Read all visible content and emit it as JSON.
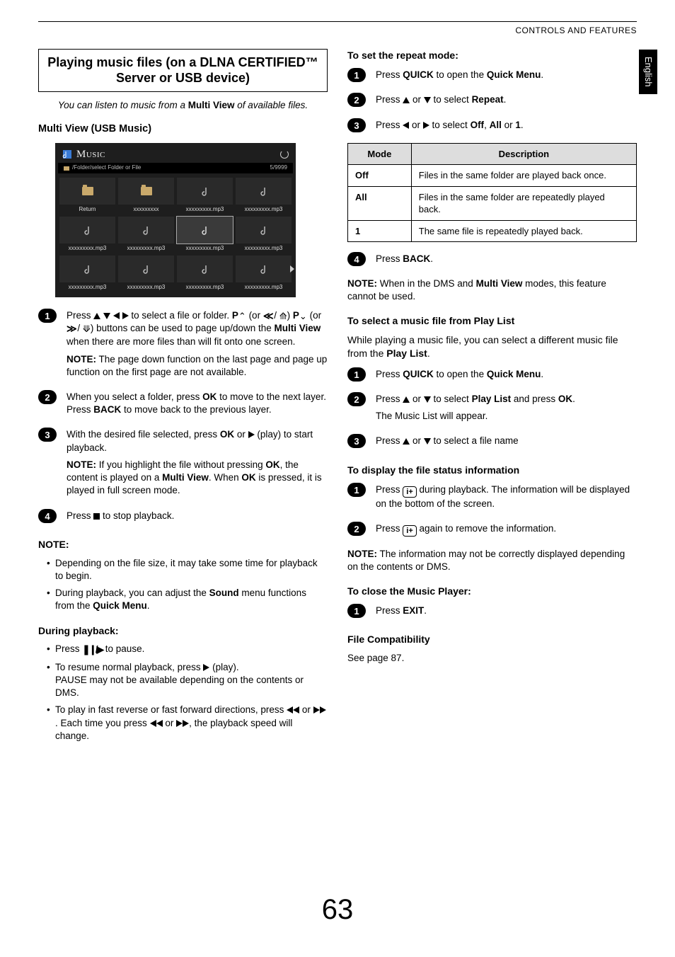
{
  "header": {
    "section": "CONTROLS AND FEATURES",
    "language": "English"
  },
  "page_number": "63",
  "left": {
    "title": "Playing music files (on a DLNA CERTIFIED™ Server or USB device)",
    "intro_pre": "You can listen to music from a ",
    "intro_bold": "Multi View",
    "intro_post": " of available files.",
    "multi_view_head": "Multi View (USB Music)",
    "screenshot": {
      "title": "Music",
      "breadcrumb": "/Folder/select Folder or File",
      "counter": "5/9999",
      "return_label": "Return",
      "folder_label": "xxxxxxxxx",
      "file_label": "xxxxxxxxx.mp3"
    },
    "steps": [
      {
        "lines": [
          "Press ▲ ▼ ◀ ▶ to select a file or folder. P▲ (or ≪ / ⟰) P▼ (or ≫ / ⟱) buttons can be used to page up/down the Multi View when there are more files than will fit onto one screen."
        ],
        "note": "NOTE: The page down function on the last page and page up function on the first page are not available."
      },
      {
        "lines": [
          "When you select a folder, press OK to move to the next layer. Press BACK to move back to the previous layer."
        ]
      },
      {
        "lines": [
          "With the desired file selected, press OK or ▶ (play) to start playback."
        ],
        "note": "NOTE: If you highlight the file without pressing OK, the content is played on a Multi View. When OK is pressed, it is played in full screen mode."
      },
      {
        "lines": [
          "Press ■ to stop playback."
        ]
      }
    ],
    "note_head": "NOTE:",
    "note_bullets": [
      "Depending on the file size, it may take some time for playback to begin.",
      "During playback, you can adjust the Sound menu functions from the Quick Menu."
    ],
    "during_head": "During playback:",
    "during_bullets": [
      "Press ❚❚/▶ to pause.",
      "To resume normal playback, press ▶ (play).\nPAUSE may not be available depending on the contents or DMS.",
      "To play in fast reverse or fast forward directions, press ◀◀ or ▶▶. Each time you press ◀◀ or ▶▶, the playback speed will change."
    ]
  },
  "right": {
    "repeat_head": "To set the repeat mode:",
    "repeat_steps": [
      "Press QUICK to open the Quick Menu.",
      "Press ▲ or ▼ to select Repeat.",
      "Press ◀ or ▶ to select Off, All or 1."
    ],
    "table": {
      "head_mode": "Mode",
      "head_desc": "Description",
      "rows": [
        {
          "mode": "Off",
          "desc": "Files in the same folder are played back once."
        },
        {
          "mode": "All",
          "desc": "Files in the same folder are repeatedly played back."
        },
        {
          "mode": "1",
          "desc": "The same file is repeatedly played back."
        }
      ]
    },
    "repeat_step4": "Press BACK.",
    "repeat_note_pre": "NOTE: ",
    "repeat_note": "When in the DMS and Multi View modes, this feature cannot be used.",
    "playlist_head": "To select a music file from Play List",
    "playlist_intro": "While playing a music file, you can select a different music file from the Play List.",
    "playlist_steps": [
      "Press QUICK to open the Quick Menu.",
      "Press ▲ or ▼ to select Play List and press OK.",
      "Press ▲ or ▼ to select a file name"
    ],
    "playlist_sub": "The Music List will appear.",
    "status_head": "To display the file status information",
    "status_steps": [
      "Press  i+  during playback. The information will be displayed on the bottom of the screen.",
      "Press  i+  again to remove the information."
    ],
    "status_note": "NOTE: The information may not be correctly displayed depending on the contents or DMS.",
    "close_head": "To close the Music Player:",
    "close_step": "Press EXIT.",
    "compat_head": "File Compatibility",
    "compat_text": "See page 87."
  }
}
